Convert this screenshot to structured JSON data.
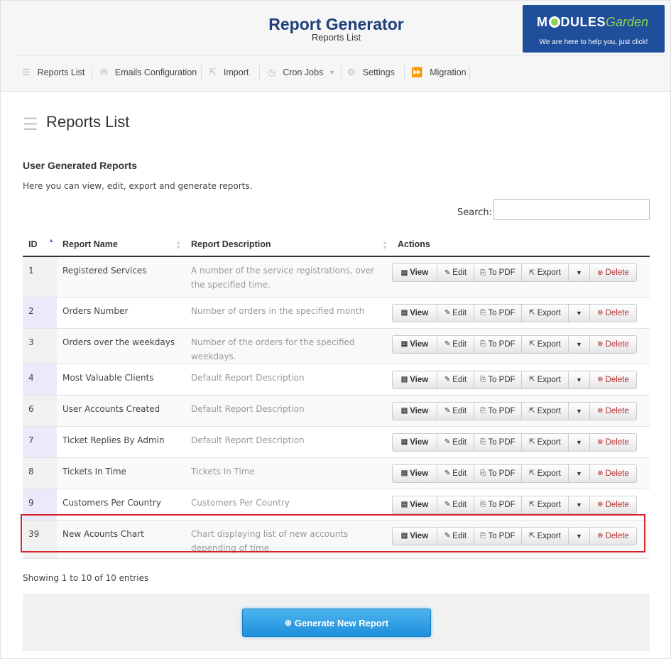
{
  "app": {
    "title": "Report Generator",
    "subtitle": "Reports List",
    "logo": {
      "brand_pre": "M",
      "brand_post": "DULES",
      "brand_garden": "Garden",
      "tagline": "We are here to help you, just click!"
    }
  },
  "nav": {
    "items": [
      {
        "label": "Reports List",
        "icon": "list-icon"
      },
      {
        "label": "Emails Configuration",
        "icon": "envelope-icon"
      },
      {
        "label": "Import",
        "icon": "share-icon"
      },
      {
        "label": "Cron Jobs",
        "icon": "clock-icon"
      },
      {
        "label": "Settings",
        "icon": "gears-icon"
      },
      {
        "label": "Migration",
        "icon": "fast-forward-icon"
      }
    ]
  },
  "page": {
    "title": "Reports List",
    "section_title": "User Generated Reports",
    "section_desc": "Here you can view, edit, export and generate reports.",
    "search_label": "Search:",
    "search_value": ""
  },
  "table": {
    "headers": {
      "id": "ID",
      "name": "Report Name",
      "desc": "Report Description",
      "actions": "Actions"
    },
    "actions": {
      "view": "View",
      "edit": "Edit",
      "pdf": "To PDF",
      "export": "Export",
      "delete": "Delete"
    },
    "rows": [
      {
        "id": "1",
        "name": "Registered Services",
        "desc": "A number of the service registrations, over the specified time."
      },
      {
        "id": "2",
        "name": "Orders Number",
        "desc": "Number of orders in the specified month"
      },
      {
        "id": "3",
        "name": "Orders over the weekdays",
        "desc": "Number of the orders for the specified weekdays."
      },
      {
        "id": "4",
        "name": "Most Valuable Clients",
        "desc": "Default Report Description"
      },
      {
        "id": "6",
        "name": "User Accounts Created",
        "desc": "Default Report Description"
      },
      {
        "id": "7",
        "name": "Ticket Replies By Admin",
        "desc": "Default Report Description"
      },
      {
        "id": "8",
        "name": "Tickets In Time",
        "desc": "Tickets In Time"
      },
      {
        "id": "9",
        "name": "Customers Per Country",
        "desc": "Customers Per Country"
      },
      {
        "id": "39",
        "name": "New Acounts Chart",
        "desc": "Chart displaying list of new accounts depending of time."
      }
    ]
  },
  "footer": {
    "showing": "Showing 1 to 10 of 10 entries",
    "generate_label": "Generate New Report"
  },
  "colors": {
    "brand": "#1e3f7a",
    "primary_button": "#2a9ae0",
    "highlight": "#d4242b",
    "delete": "#b23030"
  }
}
